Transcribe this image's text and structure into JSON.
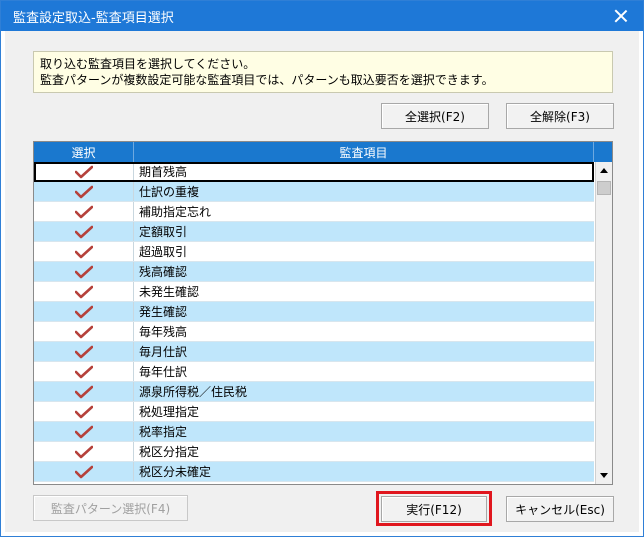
{
  "window": {
    "title": "監査設定取込-監査項目選択"
  },
  "info": {
    "line1": "取り込む監査項目を選択してください。",
    "line2": "監査パターンが複数設定可能な監査項目では、パターンも取込要否を選択できます。"
  },
  "toolbar": {
    "select_all_label": "全選択(F2)",
    "deselect_all_label": "全解除(F3)"
  },
  "grid": {
    "columns": {
      "select": "選択",
      "item": "監査項目"
    },
    "rows": [
      {
        "label": "期首残高",
        "checked": true
      },
      {
        "label": "仕訳の重複",
        "checked": true
      },
      {
        "label": "補助指定忘れ",
        "checked": true
      },
      {
        "label": "定額取引",
        "checked": true
      },
      {
        "label": "超過取引",
        "checked": true
      },
      {
        "label": "残高確認",
        "checked": true
      },
      {
        "label": "未発生確認",
        "checked": true
      },
      {
        "label": "発生確認",
        "checked": true
      },
      {
        "label": "毎年残高",
        "checked": true
      },
      {
        "label": "毎月仕訳",
        "checked": true
      },
      {
        "label": "毎年仕訳",
        "checked": true
      },
      {
        "label": "源泉所得税／住民税",
        "checked": true
      },
      {
        "label": "税処理指定",
        "checked": true
      },
      {
        "label": "税率指定",
        "checked": true
      },
      {
        "label": "税区分指定",
        "checked": true
      },
      {
        "label": "税区分未確定",
        "checked": true
      }
    ]
  },
  "footer": {
    "pattern_select_label": "監査パターン選択(F4)",
    "execute_label": "実行(F12)",
    "cancel_label": "キャンセル(Esc)"
  },
  "colors": {
    "titlebar": "#1e78d7",
    "header": "#1a78ce",
    "row_alt": "#bfe6fb",
    "check": "#b5413b",
    "highlight": "#e0161e"
  }
}
